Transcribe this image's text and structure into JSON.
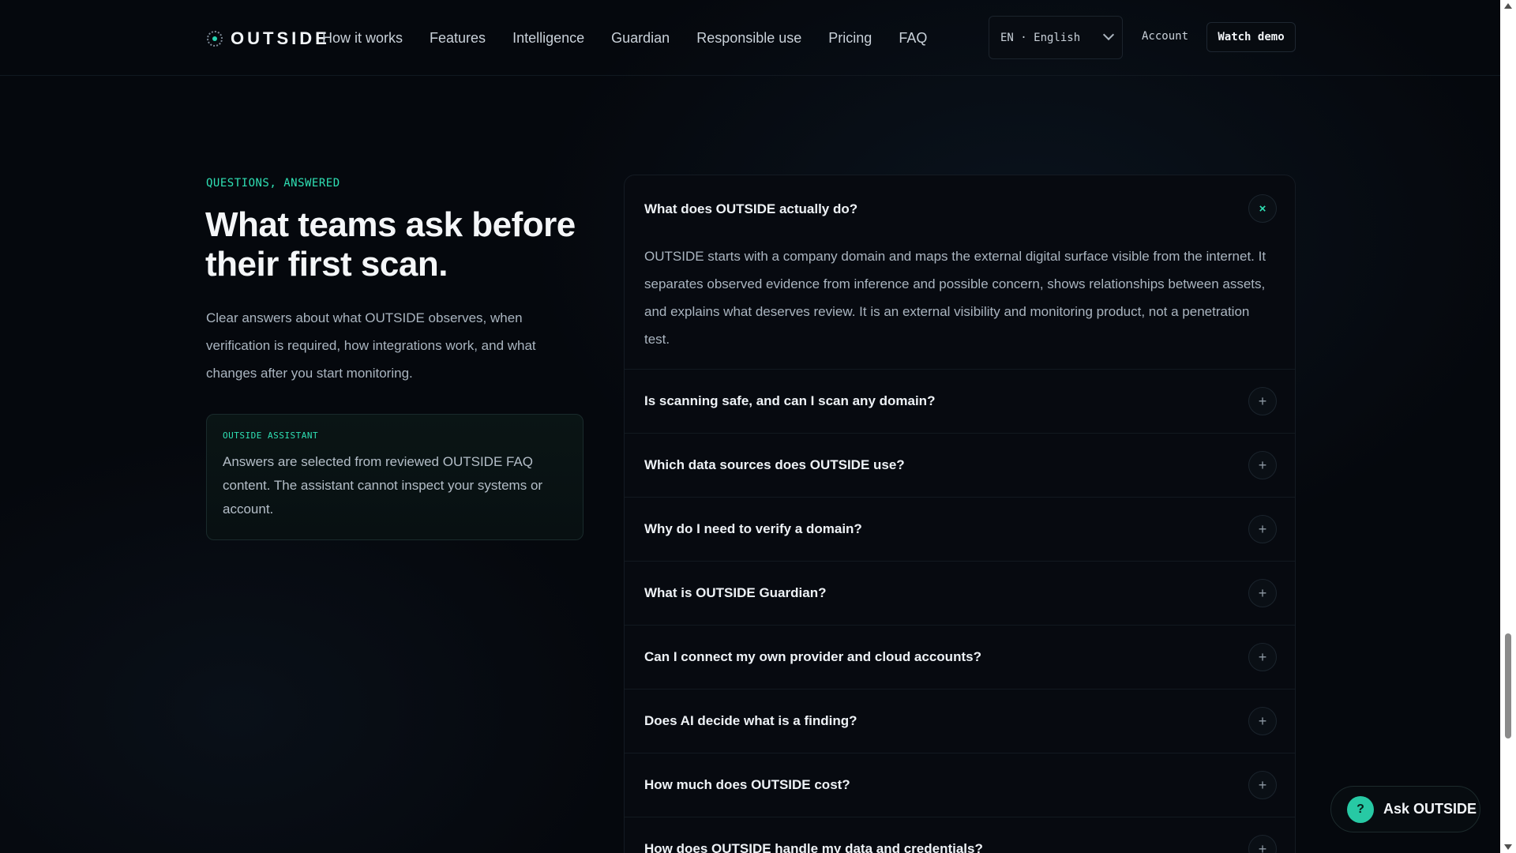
{
  "header": {
    "brand": "OUTSIDE",
    "nav": [
      "How it works",
      "Features",
      "Intelligence",
      "Guardian",
      "Responsible use",
      "Pricing",
      "FAQ"
    ],
    "language": "EN · English",
    "account": "Account",
    "demo": "Watch demo"
  },
  "intro": {
    "eyebrow": "QUESTIONS, ANSWERED",
    "title": "What teams ask before their first scan.",
    "lede": "Clear answers about what OUTSIDE observes, when verification is required, how integrations work, and what changes after you start monitoring.",
    "assistant_tag": "OUTSIDE ASSISTANT",
    "assistant_text": "Answers are selected from reviewed OUTSIDE FAQ content. The assistant cannot inspect your systems or account."
  },
  "faq": {
    "items": [
      {
        "question": "What does OUTSIDE actually do?",
        "answer": "OUTSIDE starts with a company domain and maps the external digital surface visible from the internet. It separates observed evidence from inference and possible concern, shows relationships between assets, and explains what deserves review. It is an external visibility and monitoring product, not a penetration test.",
        "open": true
      },
      {
        "question": "Is scanning safe, and can I scan any domain?",
        "open": false
      },
      {
        "question": "Which data sources does OUTSIDE use?",
        "open": false
      },
      {
        "question": "Why do I need to verify a domain?",
        "open": false
      },
      {
        "question": "What is OUTSIDE Guardian?",
        "open": false
      },
      {
        "question": "Can I connect my own provider and cloud accounts?",
        "open": false
      },
      {
        "question": "Does AI decide what is a finding?",
        "open": false
      },
      {
        "question": "How much does OUTSIDE cost?",
        "open": false
      },
      {
        "question": "How does OUTSIDE handle my data and credentials?",
        "open": false
      }
    ],
    "open_glyph": "×",
    "closed_glyph": "+"
  },
  "ask": {
    "icon": "?",
    "label": "Ask OUTSIDE"
  }
}
